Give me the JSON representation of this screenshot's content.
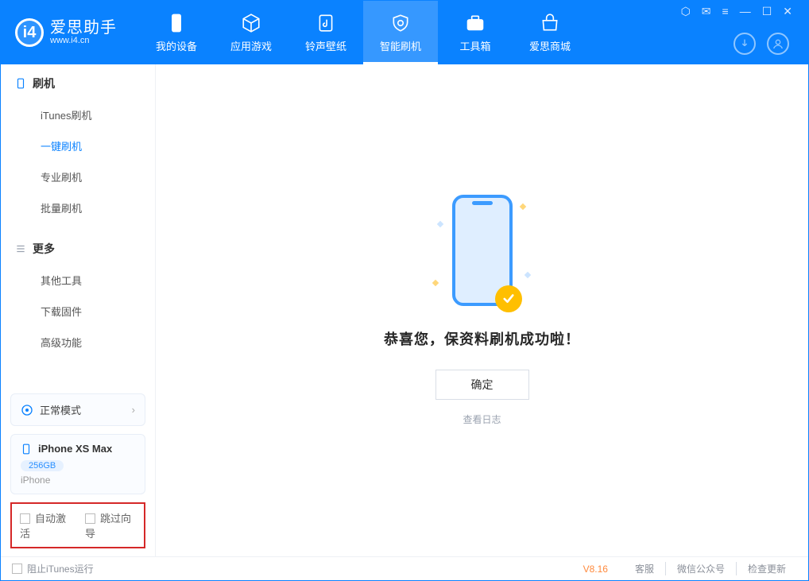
{
  "app": {
    "name": "爱思助手",
    "url": "www.i4.cn"
  },
  "nav": [
    {
      "label": "我的设备"
    },
    {
      "label": "应用游戏"
    },
    {
      "label": "铃声壁纸"
    },
    {
      "label": "智能刷机",
      "active": true
    },
    {
      "label": "工具箱"
    },
    {
      "label": "爱思商城"
    }
  ],
  "sidebar": {
    "group1": {
      "title": "刷机",
      "items": [
        "iTunes刷机",
        "一键刷机",
        "专业刷机",
        "批量刷机"
      ],
      "activeIndex": 1
    },
    "group2": {
      "title": "更多",
      "items": [
        "其他工具",
        "下载固件",
        "高级功能"
      ]
    }
  },
  "mode": {
    "label": "正常模式"
  },
  "device": {
    "name": "iPhone XS Max",
    "storage": "256GB",
    "type": "iPhone"
  },
  "options": {
    "auto_activate": "自动激活",
    "skip_guide": "跳过向导"
  },
  "result": {
    "title": "恭喜您，保资料刷机成功啦！",
    "ok": "确定",
    "view_log": "查看日志"
  },
  "footer": {
    "block_itunes": "阻止iTunes运行",
    "version": "V8.16",
    "links": [
      "客服",
      "微信公众号",
      "检查更新"
    ]
  }
}
